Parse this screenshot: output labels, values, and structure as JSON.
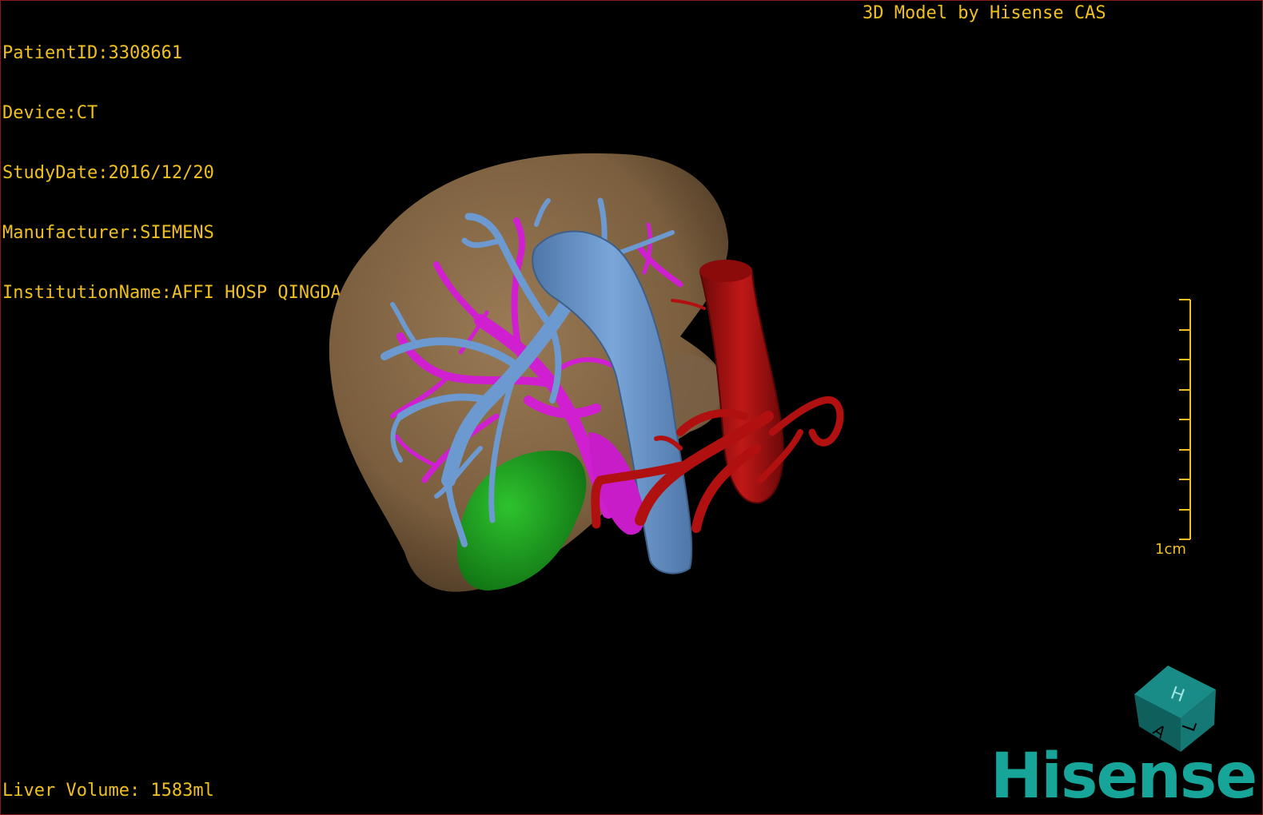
{
  "patient_info": {
    "patient_id": "PatientID:3308661",
    "device": "Device:CT",
    "study_date": "StudyDate:2016/12/20",
    "manufacturer": "Manufacturer:SIEMENS",
    "institution": "InstitutionName:AFFI HOSP QINGDAO UNI"
  },
  "model_credit": "3D Model by Hisense CAS",
  "liver_volume": "Liver Volume: 1583ml",
  "scale_bar": {
    "label": "1cm"
  },
  "orientation_cube": {
    "labels": [
      "H",
      "L",
      "A"
    ]
  },
  "brand": {
    "logo_text": "Hisense",
    "color": "#17a59a"
  },
  "colors": {
    "overlay_text": "#f0c020",
    "liver": "#8a6a45",
    "portal_vein": "#6c99cf",
    "hepatic_vein": "#d01fd0",
    "artery": "#b01010",
    "gallbladder": "#1ea020"
  }
}
